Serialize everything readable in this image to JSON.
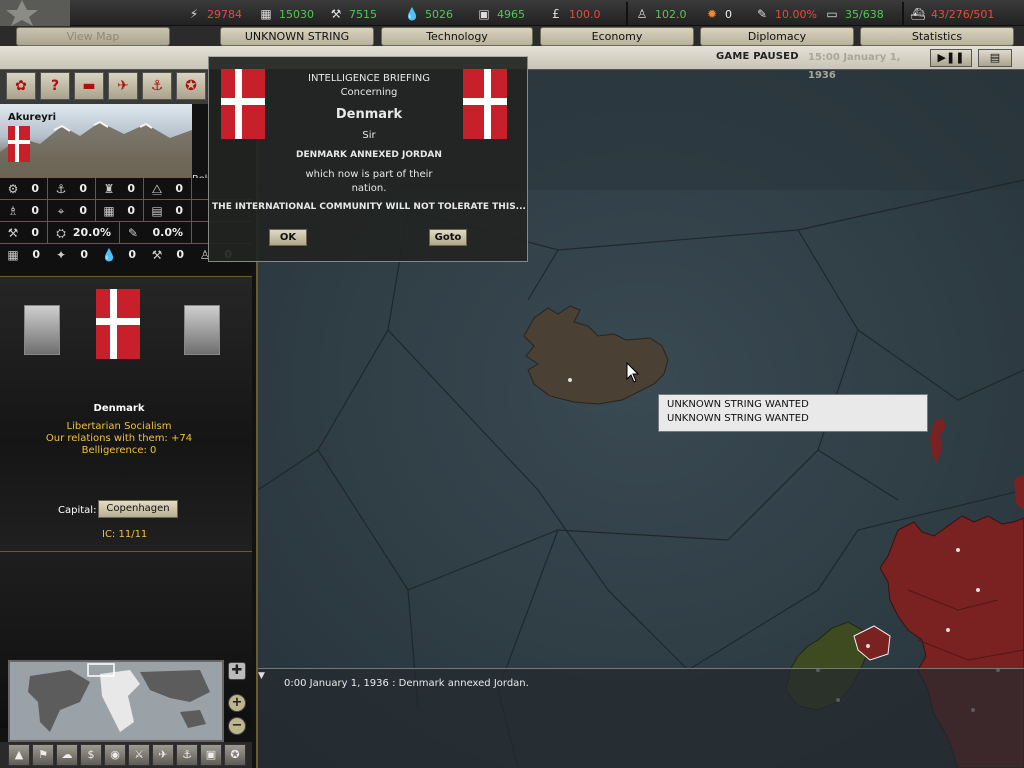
{
  "resources": {
    "energy": "29784",
    "metal": "15030",
    "rare_materials": "7515",
    "oil": "5026",
    "supplies": "4965",
    "money": "100.0",
    "manpower": "102.0",
    "nuclear": "0",
    "dissent": "10.00%",
    "transports": "35/638",
    "convoys": "43/276/501"
  },
  "tabs": {
    "view_map": "View Map",
    "unknown": "UNKNOWN STRING WANTED",
    "technology": "Technology",
    "economy": "Economy",
    "diplomacy": "Diplomacy",
    "statistics": "Statistics"
  },
  "status": {
    "paused": "GAME PAUSED",
    "date": "15:00 January 1, 1936"
  },
  "province": {
    "name": "Akureyri",
    "side_label": "Rek"
  },
  "province_stats": {
    "row1": [
      "0",
      "0",
      "0",
      "0"
    ],
    "row2": [
      "0",
      "0",
      "0",
      "0"
    ],
    "row3": [
      "0",
      "20.0%",
      "0.0%"
    ],
    "row4": [
      "0",
      "0",
      "0",
      "0",
      "0"
    ]
  },
  "country": {
    "name": "Denmark",
    "ideology": "Libertarian Socialism",
    "relations": "Our relations with them: +74",
    "belligerence": "Belligerence: 0",
    "capital_label": "Capital:",
    "capital": "Copenhagen",
    "ic": "IC: 11/11"
  },
  "popup": {
    "header": "INTELLIGENCE BRIEFING",
    "concerning": "Concerning",
    "country": "Denmark",
    "salutation": "Sir",
    "event": "DENMARK ANNEXED JORDAN",
    "detail": "which now is part of their nation.",
    "warning": "THE INTERNATIONAL COMMUNITY WILL NOT TOLERATE THIS...",
    "ok": "OK",
    "goto": "Goto"
  },
  "tooltip": {
    "line1": "UNKNOWN STRING WANTED",
    "line2": "UNKNOWN STRING WANTED"
  },
  "log": {
    "line1": "0:00 January 1, 1936 : Denmark annexed Jordan."
  },
  "colors": {
    "flag_red": "#c8202a",
    "uk_red": "#7a2222",
    "ireland_green": "#3e4a20",
    "iceland_brown": "#4a4034",
    "positive_green": "#56d25c",
    "negative_red": "#e84a3a",
    "info_gold": "#f0c040"
  }
}
